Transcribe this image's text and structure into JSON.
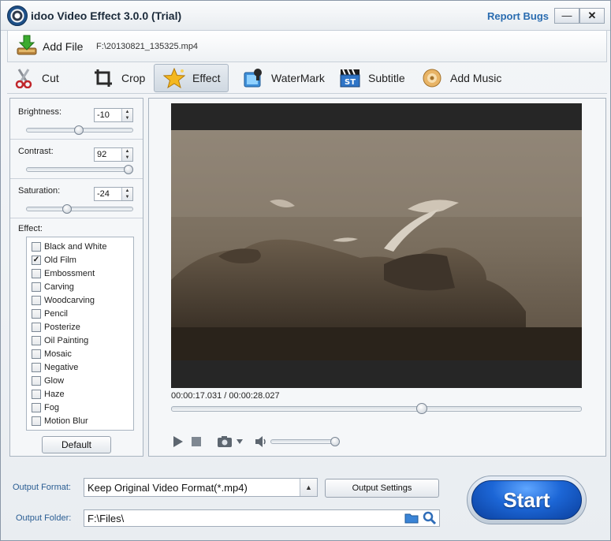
{
  "window": {
    "title": "idoo Video Effect 3.0.0 (Trial)",
    "report_bugs": "Report Bugs",
    "minimize": "—",
    "close": "✕"
  },
  "file": {
    "add_label": "Add File",
    "path": "F:\\20130821_135325.mp4"
  },
  "tabs": [
    {
      "label": "Cut",
      "icon": "scissors-icon"
    },
    {
      "label": "Crop",
      "icon": "crop-icon"
    },
    {
      "label": "Effect",
      "icon": "star-effect-icon",
      "active": true
    },
    {
      "label": "WaterMark",
      "icon": "watermark-icon"
    },
    {
      "label": "Subtitle",
      "icon": "subtitle-clapper-icon"
    },
    {
      "label": "Add Music",
      "icon": "music-disc-icon"
    }
  ],
  "adjust": {
    "brightness": {
      "label": "Brightness:",
      "value": "-10",
      "level": 0.49
    },
    "contrast": {
      "label": "Contrast:",
      "value": "92",
      "level": 0.96
    },
    "saturation": {
      "label": "Saturation:",
      "value": "-24",
      "level": 0.38
    }
  },
  "effects": {
    "label": "Effect:",
    "items": [
      {
        "label": "Black and White",
        "checked": false
      },
      {
        "label": "Old Film",
        "checked": true
      },
      {
        "label": "Embossment",
        "checked": false
      },
      {
        "label": "Carving",
        "checked": false
      },
      {
        "label": "Woodcarving",
        "checked": false
      },
      {
        "label": "Pencil",
        "checked": false
      },
      {
        "label": "Posterize",
        "checked": false
      },
      {
        "label": "Oil Painting",
        "checked": false
      },
      {
        "label": "Mosaic",
        "checked": false
      },
      {
        "label": "Negative",
        "checked": false
      },
      {
        "label": "Glow",
        "checked": false
      },
      {
        "label": "Haze",
        "checked": false
      },
      {
        "label": "Fog",
        "checked": false
      },
      {
        "label": "Motion Blur",
        "checked": false
      }
    ],
    "default_label": "Default"
  },
  "player": {
    "timecode": "00:00:17.031 / 00:00:28.027",
    "position": 0.61,
    "volume": 0.97
  },
  "output": {
    "format_label": "Output Format:",
    "format_value": "Keep Original Video Format(*.mp4)",
    "settings_label": "Output Settings",
    "folder_label": "Output Folder:",
    "folder_value": "F:\\Files\\",
    "start_label": "Start"
  },
  "colors": {
    "accent": "#2a6cb0",
    "start": "#1c66d6",
    "sepia": "#857867"
  }
}
